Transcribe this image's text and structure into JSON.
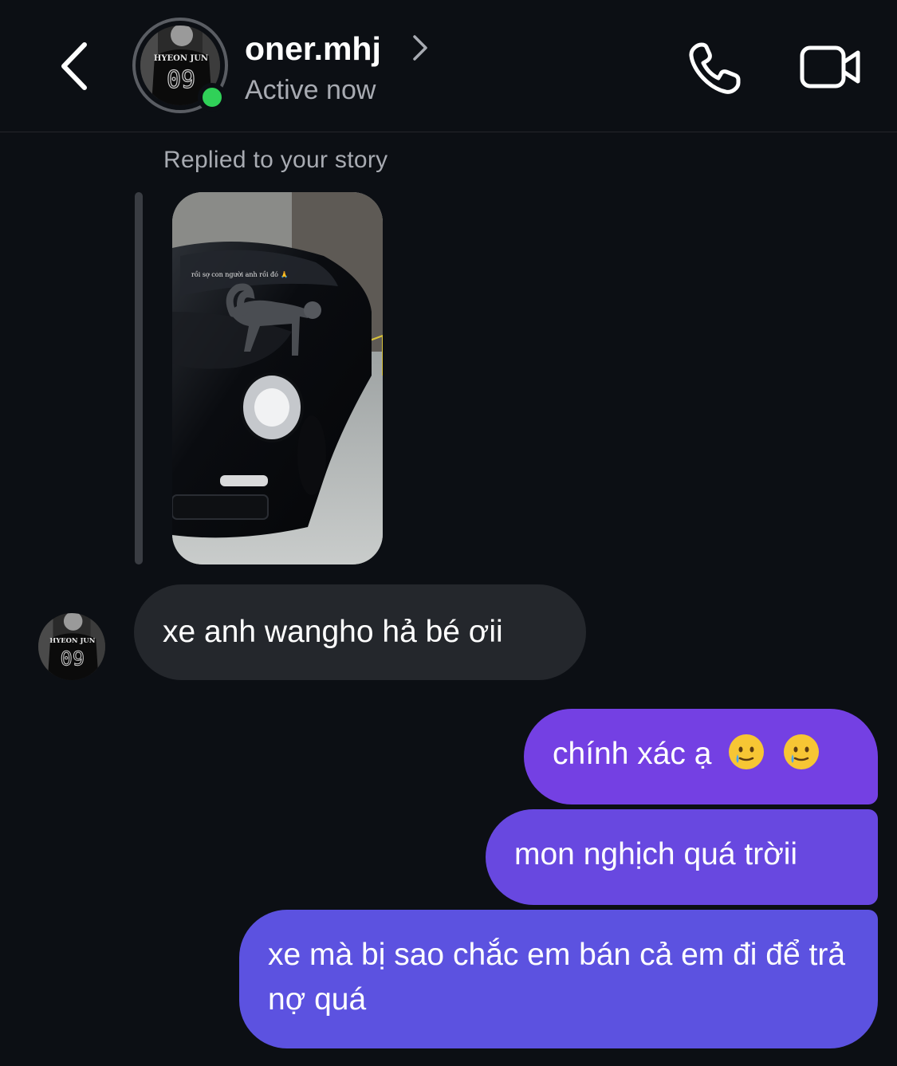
{
  "header": {
    "username": "oner.mhj",
    "status": "Active now",
    "avatar_jersey_name": "HYEON JUN",
    "avatar_jersey_number": "09",
    "online_color": "#30d158"
  },
  "story_reply": {
    "label": "Replied to your story",
    "caption": "rồi sợ con người anh rồi đó 🙏"
  },
  "messages": [
    {
      "sender": "them",
      "text": "xe anh wangho hả bé ơii"
    },
    {
      "sender": "me",
      "text": "chính xác ạ",
      "emojis": [
        "smiling-face-with-tear",
        "smiling-face-with-tear"
      ]
    },
    {
      "sender": "me",
      "text": "mon nghịch quá trờii"
    },
    {
      "sender": "me",
      "text": "xe mà bị sao chắc em bán cả em đi để trả nợ quá"
    }
  ],
  "colors": {
    "background": "#0c0f14",
    "incoming_bubble": "#24272c",
    "outgoing_bubble_top": "#7440e3",
    "outgoing_bubble_bottom": "#5c52e0"
  }
}
